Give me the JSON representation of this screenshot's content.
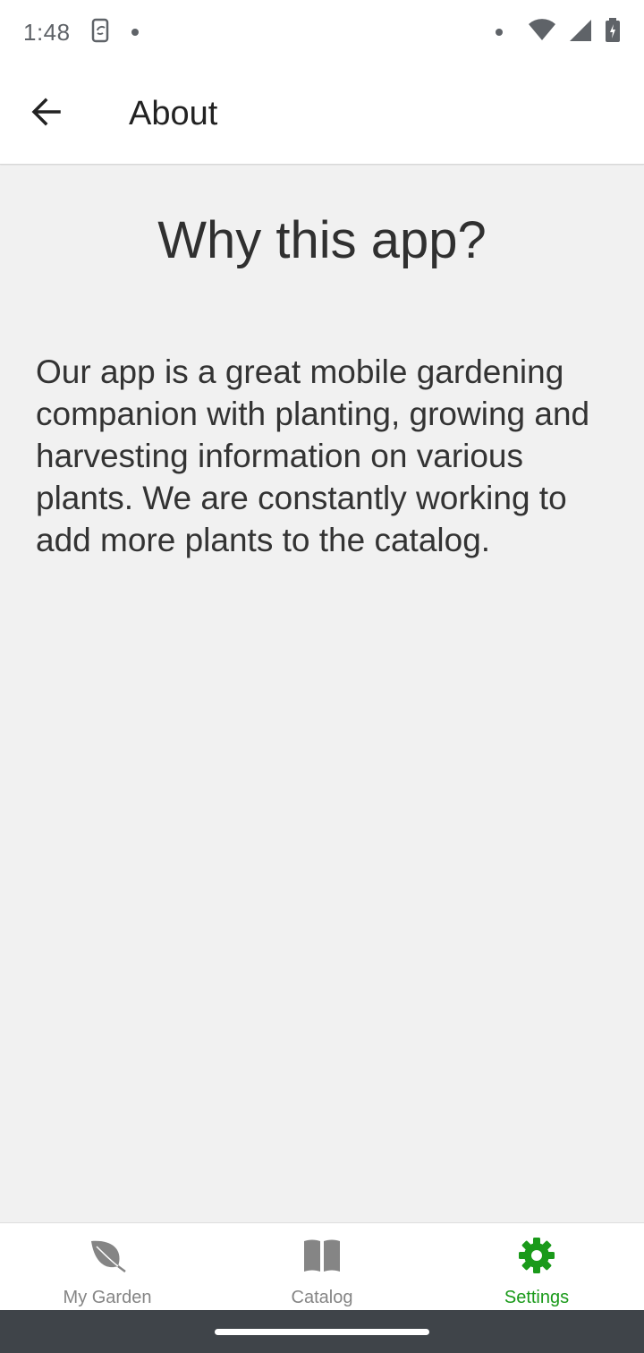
{
  "status_bar": {
    "time": "1:48"
  },
  "app_bar": {
    "title": "About"
  },
  "content": {
    "heading": "Why this app?",
    "body": "Our app is a great mobile gardening companion with planting, growing and harvesting information on various plants. We are constantly working to add more plants to the catalog."
  },
  "bottom_nav": {
    "items": [
      {
        "label": "My Garden",
        "icon": "leaf-icon",
        "active": false
      },
      {
        "label": "Catalog",
        "icon": "book-icon",
        "active": false
      },
      {
        "label": "Settings",
        "icon": "gear-icon",
        "active": true
      }
    ]
  },
  "colors": {
    "accent": "#1a9a1a",
    "inactive": "#858585",
    "background": "#f1f1f1",
    "nav_bar": "#3f4449"
  }
}
